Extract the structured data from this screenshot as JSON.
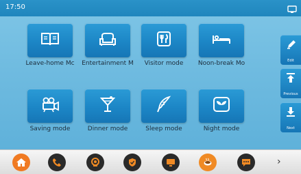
{
  "status": {
    "time": "17:50",
    "icon": "monitor-icon"
  },
  "modes": [
    {
      "label": "Leave-home Mc",
      "icon": "book-icon"
    },
    {
      "label": "Entertainment M",
      "icon": "sofa-icon"
    },
    {
      "label": "Visitor mode",
      "icon": "cutlery-icon"
    },
    {
      "label": "Noon-break Mo",
      "icon": "bed-icon"
    },
    {
      "label": "Saving mode",
      "icon": "projector-icon"
    },
    {
      "label": "Dinner mode",
      "icon": "cocktail-icon"
    },
    {
      "label": "Sleep mode",
      "icon": "feather-icon"
    },
    {
      "label": "Night mode",
      "icon": "leaf-icon"
    }
  ],
  "nav": {
    "edit": "Edit",
    "previous": "Previous",
    "next": "Next"
  },
  "dock": {
    "items": [
      {
        "icon": "home-icon",
        "color": "#f07a22"
      },
      {
        "icon": "phone-icon",
        "color": "#2a2a2a"
      },
      {
        "icon": "camera-icon",
        "color": "#2a2a2a"
      },
      {
        "icon": "shield-icon",
        "color": "#2a2a2a"
      },
      {
        "icon": "monitor-icon",
        "color": "#2a2a2a"
      },
      {
        "icon": "coffee-icon",
        "color": "#2a2a2a"
      },
      {
        "icon": "message-icon",
        "color": "#2a2a2a"
      }
    ],
    "more": "›"
  },
  "colors": {
    "accent": "#1f86bd",
    "home": "#f07a22",
    "orange_icon": "#f08a24"
  }
}
